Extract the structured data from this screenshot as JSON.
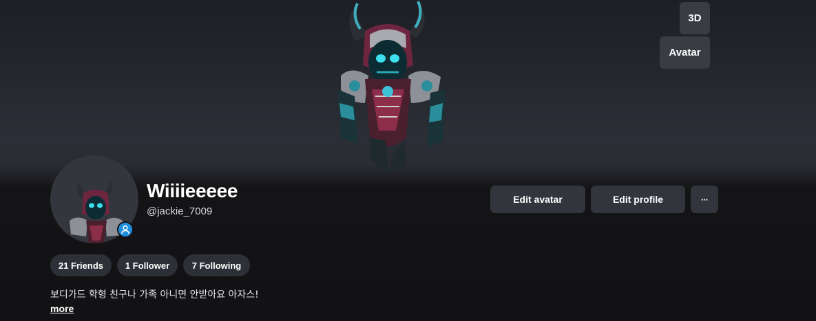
{
  "profile": {
    "display_name": "Wiiiieeeee",
    "username": "@jackie_7009",
    "bio": "보디가드 학형 친구나 가족 아니면 안받아요 아자스!",
    "more_label": "more"
  },
  "viewer": {
    "btn_3d": "3D",
    "btn_avatar": "Avatar"
  },
  "actions": {
    "edit_avatar": "Edit avatar",
    "edit_profile": "Edit profile",
    "more_options": "···"
  },
  "stats": [
    {
      "label": "21 Friends"
    },
    {
      "label": "1 Follower"
    },
    {
      "label": "7 Following"
    }
  ],
  "icons": {
    "status": "user-icon",
    "more": "ellipsis-icon"
  },
  "colors": {
    "status_badge": "#1f8fe0",
    "button_bg": "#33353d"
  }
}
